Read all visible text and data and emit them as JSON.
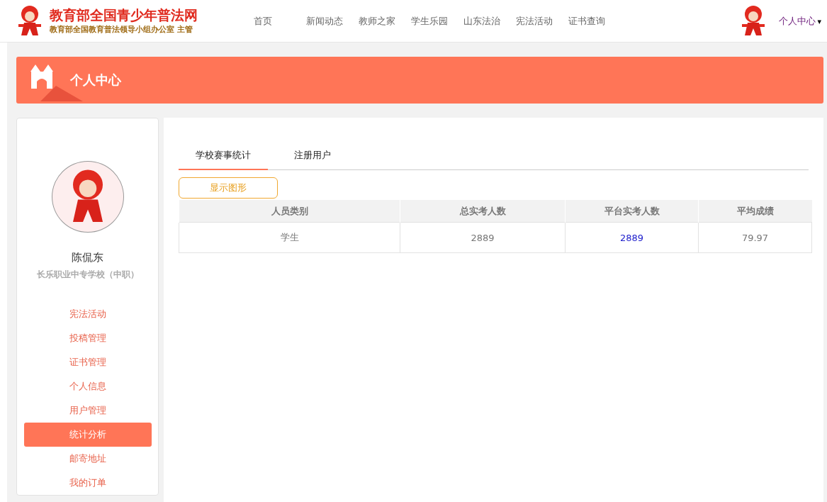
{
  "header": {
    "site_title": "教育部全国青少年普法网",
    "site_subtitle": "教育部全国教育普法领导小组办公室 主管",
    "nav": [
      {
        "label": "首页",
        "selected": false
      },
      {
        "label": "新闻动态",
        "selected": false
      },
      {
        "label": "教师之家",
        "selected": false
      },
      {
        "label": "学生乐园",
        "selected": false
      },
      {
        "label": "山东法治",
        "selected": false
      },
      {
        "label": "宪法活动",
        "selected": false
      },
      {
        "label": "证书查询",
        "selected": false
      }
    ],
    "user_menu": "个人中心",
    "user_menu_caret": "▾"
  },
  "banner": {
    "title": "个人中心"
  },
  "sidebar": {
    "name": "陈侃东",
    "school": "长乐职业中专学校（中职）",
    "items": [
      {
        "label": "宪法活动",
        "selected": false
      },
      {
        "label": "投稿管理",
        "selected": false
      },
      {
        "label": "证书管理",
        "selected": false
      },
      {
        "label": "个人信息",
        "selected": false
      },
      {
        "label": "用户管理",
        "selected": false
      },
      {
        "label": "统计分析",
        "selected": true
      },
      {
        "label": "邮寄地址",
        "selected": false
      },
      {
        "label": "我的订单",
        "selected": false
      }
    ]
  },
  "tabs": [
    {
      "label": "学校赛事统计",
      "selected": true
    },
    {
      "label": "注册用户",
      "selected": false
    }
  ],
  "show_chart_button": "显示图形",
  "table": {
    "columns": [
      "人员类别",
      "总实考人数",
      "平台实考人数",
      "平均成绩"
    ],
    "rows": [
      [
        {
          "text": "学生",
          "kind": "plain"
        },
        {
          "text": "2889",
          "kind": "plain"
        },
        {
          "text": "2889",
          "kind": "link"
        },
        {
          "text": "79.97",
          "kind": "plain"
        }
      ]
    ]
  }
}
